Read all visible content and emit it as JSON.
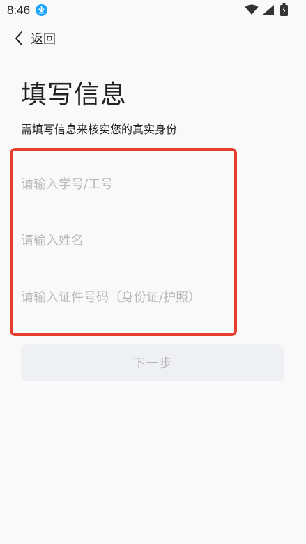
{
  "status_bar": {
    "time": "8:46",
    "download_icon": "download-icon",
    "wifi_icon": "wifi-icon",
    "signal_icon": "signal-icon",
    "battery_icon": "battery-charging-icon"
  },
  "header": {
    "back_label": "返回"
  },
  "page": {
    "title": "填写信息",
    "subtitle": "需填写信息来核实您的真实身份"
  },
  "form": {
    "student_id_placeholder": "请输入学号/工号",
    "name_placeholder": "请输入姓名",
    "id_number_placeholder": "请输入证件号码（身份证/护照）"
  },
  "actions": {
    "next_label": "下一步"
  },
  "colors": {
    "accent_download": "#1aa3ff",
    "highlight_border": "#e53e2f",
    "button_bg": "#eff0f4",
    "placeholder": "#b8b8bd"
  }
}
